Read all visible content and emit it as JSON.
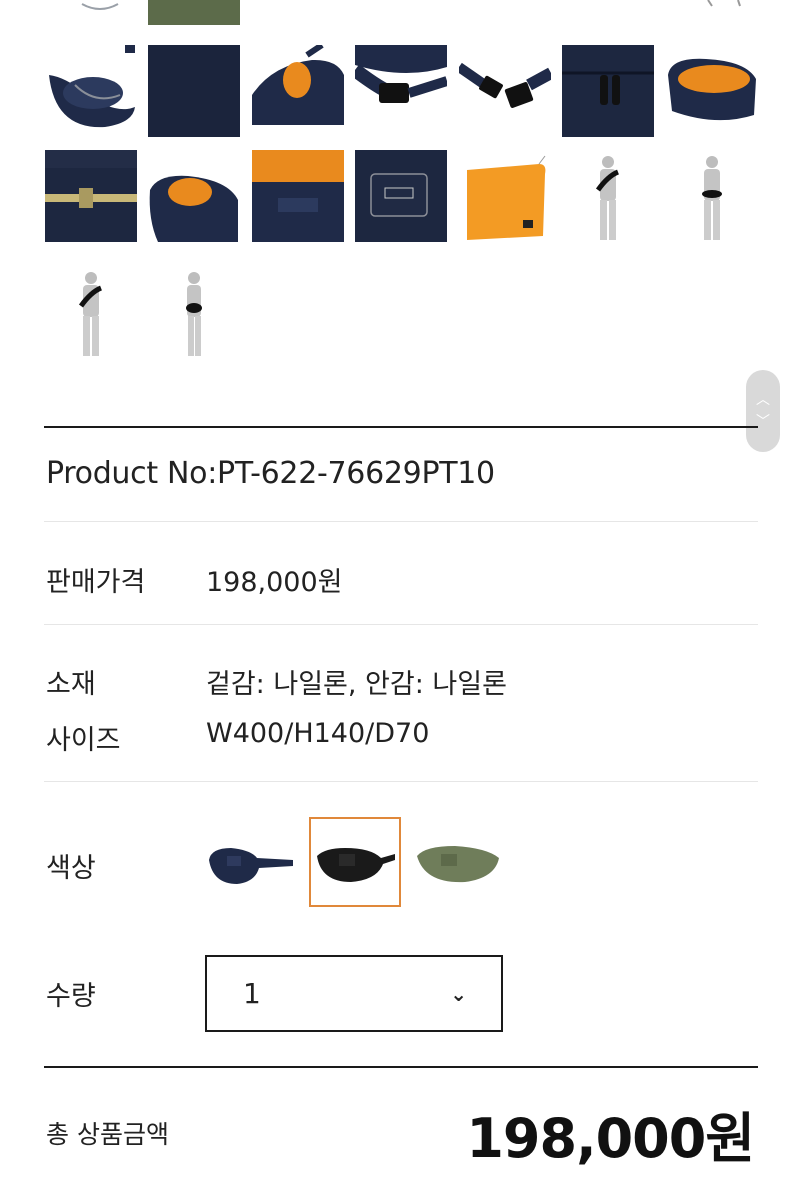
{
  "gallery": {
    "thumbnails": [
      {
        "name": "bag-open-navy",
        "bg": "#ffffff"
      },
      {
        "name": "fabric-closeup-navy",
        "bg": "#1d2740"
      },
      {
        "name": "bag-orange-lining",
        "bg": "#ffffff"
      },
      {
        "name": "strap-buckle-closed",
        "bg": "#ffffff"
      },
      {
        "name": "strap-buckle-open",
        "bg": "#ffffff"
      },
      {
        "name": "zipper-pulls",
        "bg": "#1d2740"
      },
      {
        "name": "bag-orange-interior",
        "bg": "#ffffff"
      },
      {
        "name": "zipper-closeup",
        "bg": "#1d2740"
      },
      {
        "name": "bag-side-orange",
        "bg": "#ffffff"
      },
      {
        "name": "interior-pocket-label",
        "bg": "#e98a1e"
      },
      {
        "name": "porter-label",
        "bg": "#1d2740"
      },
      {
        "name": "orange-dust-bag",
        "bg": "#ffffff"
      },
      {
        "name": "model-front-shoulder",
        "bg": "#ffffff"
      },
      {
        "name": "model-front-waist",
        "bg": "#ffffff"
      },
      {
        "name": "model-back-shoulder",
        "bg": "#ffffff"
      },
      {
        "name": "model-side-waist",
        "bg": "#ffffff"
      }
    ]
  },
  "product": {
    "product_no": "Product No:PT-622-76629PT10",
    "price_label": "판매가격",
    "price_value": "198,000원",
    "material_label": "소재",
    "material_value": "겉감: 나일론, 안감: 나일론",
    "size_label": "사이즈",
    "size_value": "W400/H140/D70",
    "color_label": "색상",
    "colors": [
      {
        "name": "navy",
        "hex": "#1f2a48",
        "selected": false
      },
      {
        "name": "black",
        "hex": "#1a1a1a",
        "selected": true
      },
      {
        "name": "olive",
        "hex": "#6f7d5a",
        "selected": false
      }
    ],
    "quantity_label": "수량",
    "quantity_value": "1"
  },
  "total": {
    "label": "총 상품금액",
    "value": "198,000원"
  },
  "colors": {
    "accent": "#e0883a",
    "navy": "#1d2740",
    "orange": "#e98a1e"
  }
}
